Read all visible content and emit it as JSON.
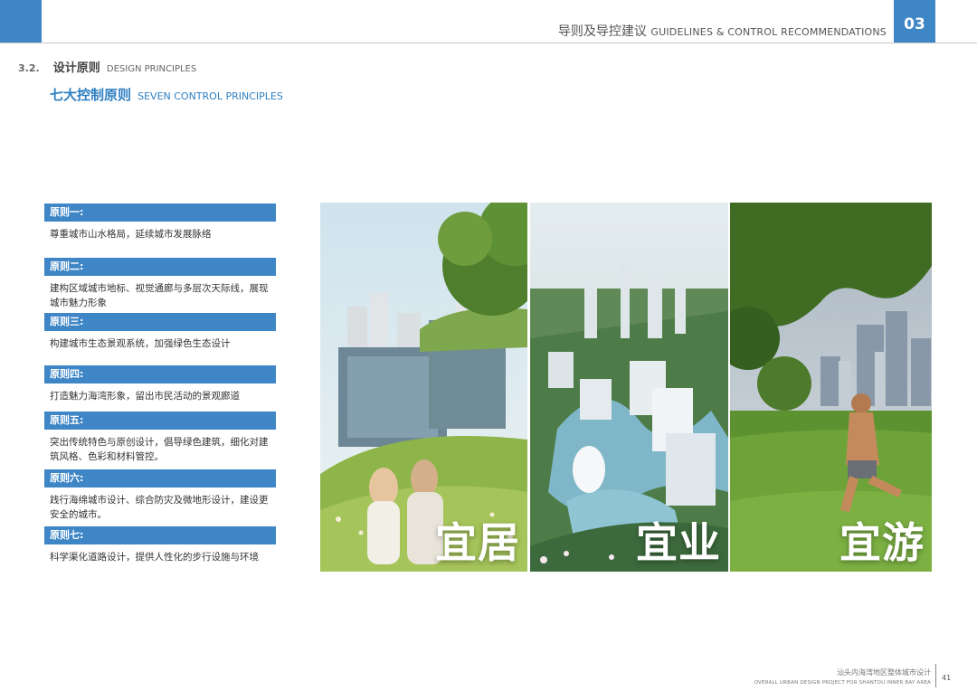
{
  "header": {
    "title_zh": "导则及导控建议",
    "title_en": "GUIDELINES & CONTROL RECOMMENDATIONS",
    "chapter": "03",
    "accent_color": "#3f86c6"
  },
  "section": {
    "number": "3.2.",
    "title_zh": "设计原则",
    "title_en": "DESIGN PRINCIPLES"
  },
  "subsection": {
    "title_zh": "七大控制原则",
    "title_en": "SEVEN CONTROL PRINCIPLES"
  },
  "principles": [
    {
      "label": "原则一:",
      "text": "尊重城市山水格局，延续城市发展脉络"
    },
    {
      "label": "原则二:",
      "text": "建构区域城市地标、视觉通廊与多层次天际线，展现城市魅力形象"
    },
    {
      "label": "原则三:",
      "text": "构建城市生态景观系统，加强绿色生态设计"
    },
    {
      "label": "原则四:",
      "text": "打造魅力海湾形象，留出市民活动的景观廊道"
    },
    {
      "label": "原则五:",
      "text": "突出传统特色与原创设计，倡导绿色建筑，细化对建筑风格、色彩和材料管控。"
    },
    {
      "label": "原则六:",
      "text": "践行海绵城市设计、综合防灾及微地形设计，建设更安全的城市。"
    },
    {
      "label": "原则七:",
      "text": "科学渠化道路设计，提供人性化的步行设施与环境"
    }
  ],
  "photos": [
    {
      "caption": "宜居",
      "scene": "living"
    },
    {
      "caption": "宜业",
      "scene": "business"
    },
    {
      "caption": "宜游",
      "scene": "leisure"
    }
  ],
  "footer": {
    "project_zh": "汕头内海湾地区整体城市设计",
    "project_en": "OVERALL URBAN DESIGN PROJECT FOR SHANTOU INNER BAY AREA",
    "page": "41"
  }
}
